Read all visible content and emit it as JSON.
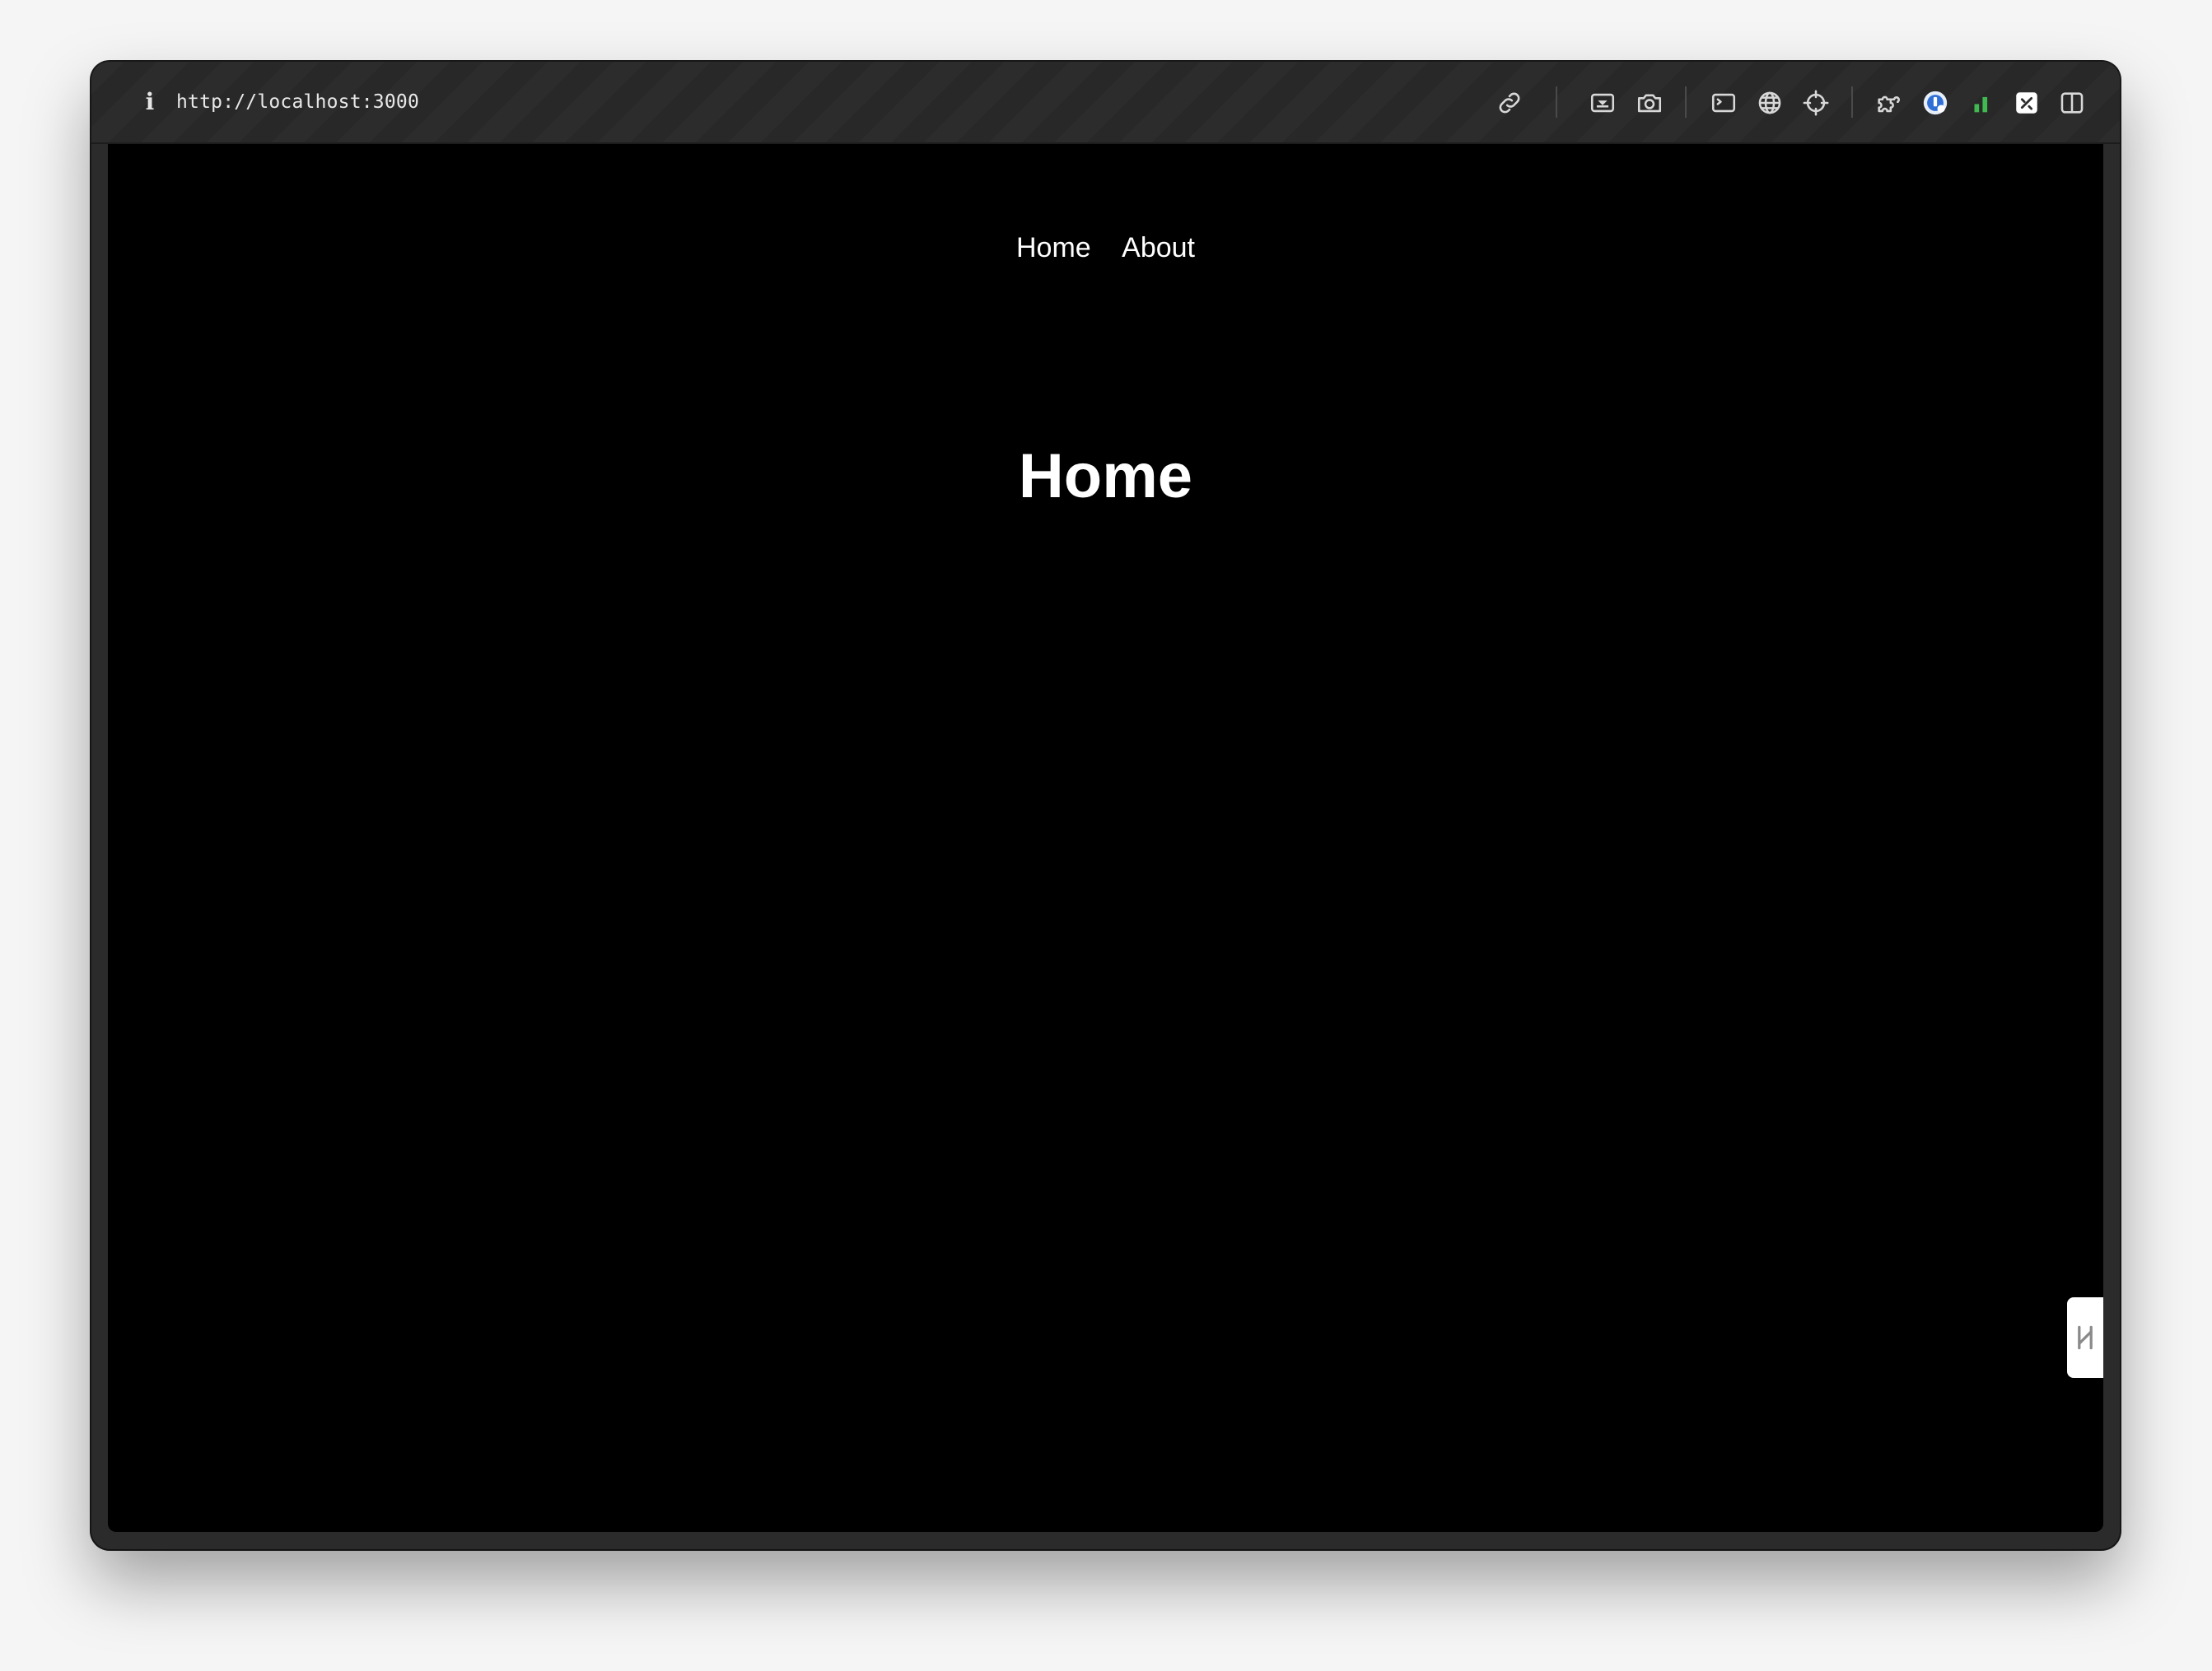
{
  "browser": {
    "url": "http://localhost:3000",
    "toolbar_icons": [
      "link-icon",
      "responsive-icon",
      "camera-icon",
      "terminal-icon",
      "globe-icon",
      "crosshair-icon",
      "extensions-icon",
      "profile-icon",
      "signal-icon",
      "devtools-icon",
      "sidebar-icon"
    ],
    "signal_color": "#3fb950"
  },
  "page": {
    "nav": {
      "items": [
        {
          "label": "Home"
        },
        {
          "label": "About"
        }
      ]
    },
    "heading": "Home",
    "background": "#000000",
    "text_color": "#ffffff"
  },
  "side_tab": {
    "icon": "drag-handle-icon"
  }
}
